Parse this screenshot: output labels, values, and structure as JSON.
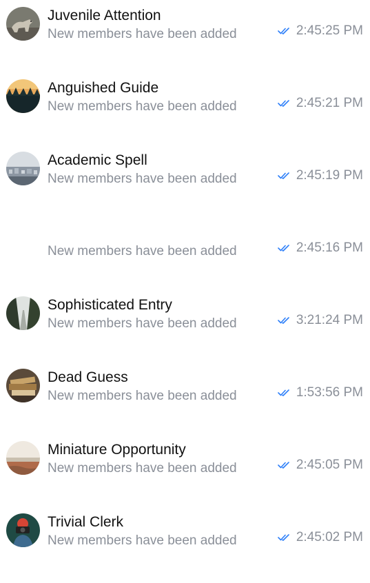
{
  "colors": {
    "check": "#2d7ff9",
    "title": "#111111",
    "subtitle": "#8a8f98",
    "time": "#8a8f98"
  },
  "chats": [
    {
      "name": "Juvenile Attention",
      "message": "New members have been added",
      "time": "2:45:25 PM",
      "avatar": "wolf"
    },
    {
      "name": "Anguished Guide",
      "message": "New members have been added",
      "time": "2:45:21 PM",
      "avatar": "forest-sunset"
    },
    {
      "name": "Academic Spell",
      "message": "New members have been added",
      "time": "2:45:19 PM",
      "avatar": "city"
    },
    {
      "name": "",
      "message": "New members have been added",
      "time": "2:45:16 PM",
      "avatar": "none"
    },
    {
      "name": "Sophisticated Entry",
      "message": "New members have been added",
      "time": "3:21:24 PM",
      "avatar": "tree-path"
    },
    {
      "name": "Dead Guess",
      "message": "New members have been added",
      "time": "1:53:56 PM",
      "avatar": "books"
    },
    {
      "name": "Miniature Opportunity",
      "message": "New members have been added",
      "time": "2:45:05 PM",
      "avatar": "field"
    },
    {
      "name": "Trivial Clerk",
      "message": "New members have been added",
      "time": "2:45:02 PM",
      "avatar": "photographer"
    }
  ]
}
